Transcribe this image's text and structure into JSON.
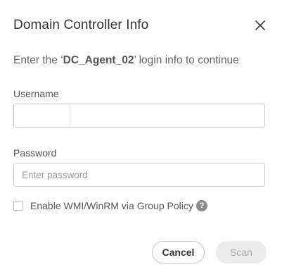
{
  "dialog": {
    "title": "Domain Controller Info",
    "close_icon": "close-icon",
    "subtitle_prefix": "Enter the ‘",
    "agent_name": "DC_Agent_02",
    "subtitle_suffix": "’ login info to continue"
  },
  "form": {
    "username_label": "Username",
    "username_value": "",
    "password_label": "Password",
    "password_placeholder": "Enter password",
    "checkbox_label": "Enable WMI/WinRM via Group Policy",
    "checkbox_checked": false,
    "help_icon": "question-circle-icon",
    "help_glyph": "?"
  },
  "actions": {
    "cancel_label": "Cancel",
    "scan_label": "Scan",
    "scan_disabled": true
  },
  "colors": {
    "title_text": "#333333",
    "muted_text": "#666666",
    "border": "#c9c9c9",
    "disabled_bg": "#ececec",
    "disabled_text": "#aaaaaa",
    "help_bg": "#8c8c8c"
  }
}
